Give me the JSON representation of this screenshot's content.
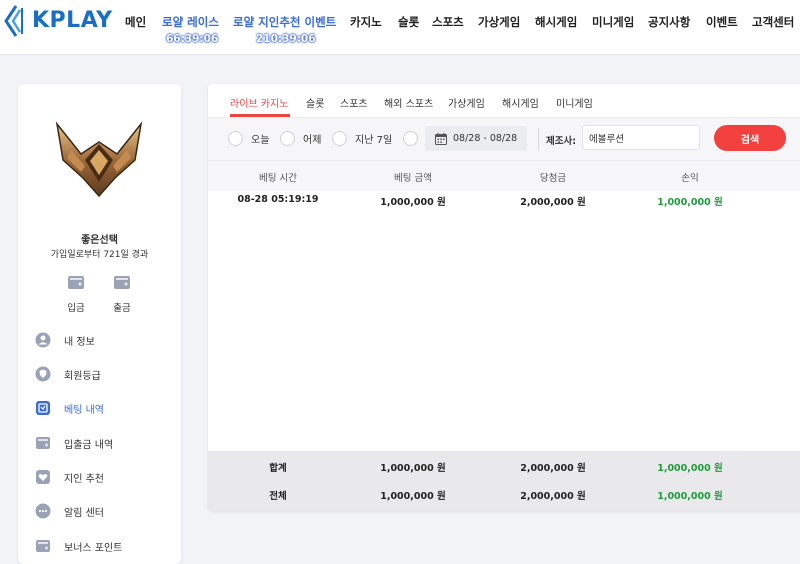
{
  "header": {
    "logo_text": "KPLAY",
    "nav": [
      {
        "label": "메인",
        "timer": ""
      },
      {
        "label": "로얄 레이스",
        "timer": "66:39:06"
      },
      {
        "label": "로얄 지인추천 이벤트",
        "timer": "210:39:06"
      },
      {
        "label": "카지노",
        "timer": ""
      },
      {
        "label": "슬롯",
        "timer": ""
      },
      {
        "label": "스포츠",
        "timer": ""
      },
      {
        "label": "가상게임",
        "timer": ""
      },
      {
        "label": "해시게임",
        "timer": ""
      },
      {
        "label": "미니게임",
        "timer": ""
      },
      {
        "label": "공지사항",
        "timer": ""
      },
      {
        "label": "이벤트",
        "timer": ""
      },
      {
        "label": "고객센터",
        "timer": ""
      }
    ]
  },
  "sidebar": {
    "user_name": "좋은선택",
    "days_since_join": "가입일로부터 721일 경과",
    "deposit_label": "입금",
    "withdraw_label": "출금",
    "menu": [
      {
        "label": "내 정보",
        "icon": "user-bubble-icon"
      },
      {
        "label": "회원등급",
        "icon": "level-shield-icon"
      },
      {
        "label": "베팅 내역",
        "icon": "betting-history-icon",
        "active": true
      },
      {
        "label": "입출금 내역",
        "icon": "transaction-icon"
      },
      {
        "label": "지인 추천",
        "icon": "heart-icon"
      },
      {
        "label": "알림 센터",
        "icon": "chat-dots-icon"
      },
      {
        "label": "보너스 포인트",
        "icon": "bonus-point-icon"
      }
    ]
  },
  "main": {
    "tabs": [
      "라이브 카지노",
      "슬롯",
      "스포츠",
      "해외 스포츠",
      "가상게임",
      "해시게임",
      "미니게임"
    ],
    "active_tab": "라이브 카지노",
    "filters": {
      "today": "오늘",
      "yesterday": "어제",
      "last7": "지난 7일",
      "date_range": "08/28 - 08/28",
      "manufacturer_label": "제조사:",
      "manufacturer_value": "에볼루션",
      "search_button": "검색"
    },
    "columns": [
      "베팅 시간",
      "베팅 금액",
      "당첨금",
      "손익"
    ],
    "rows": [
      {
        "time": "08-28 05:19:19",
        "bet": "1,000,000 원",
        "win": "2,000,000 원",
        "profit": "1,000,000 원"
      }
    ],
    "subtotal": {
      "label": "합계",
      "bet": "1,000,000 원",
      "win": "2,000,000 원",
      "profit": "1,000,000 원"
    },
    "total": {
      "label": "전체",
      "bet": "1,000,000 원",
      "win": "2,000,000 원",
      "profit": "1,000,000 원"
    }
  },
  "colors": {
    "accent_red": "#e84545",
    "active_blue": "#3a6cd6",
    "profit_green": "#1e9b3b",
    "logo_blue": "#1a6fc2"
  }
}
